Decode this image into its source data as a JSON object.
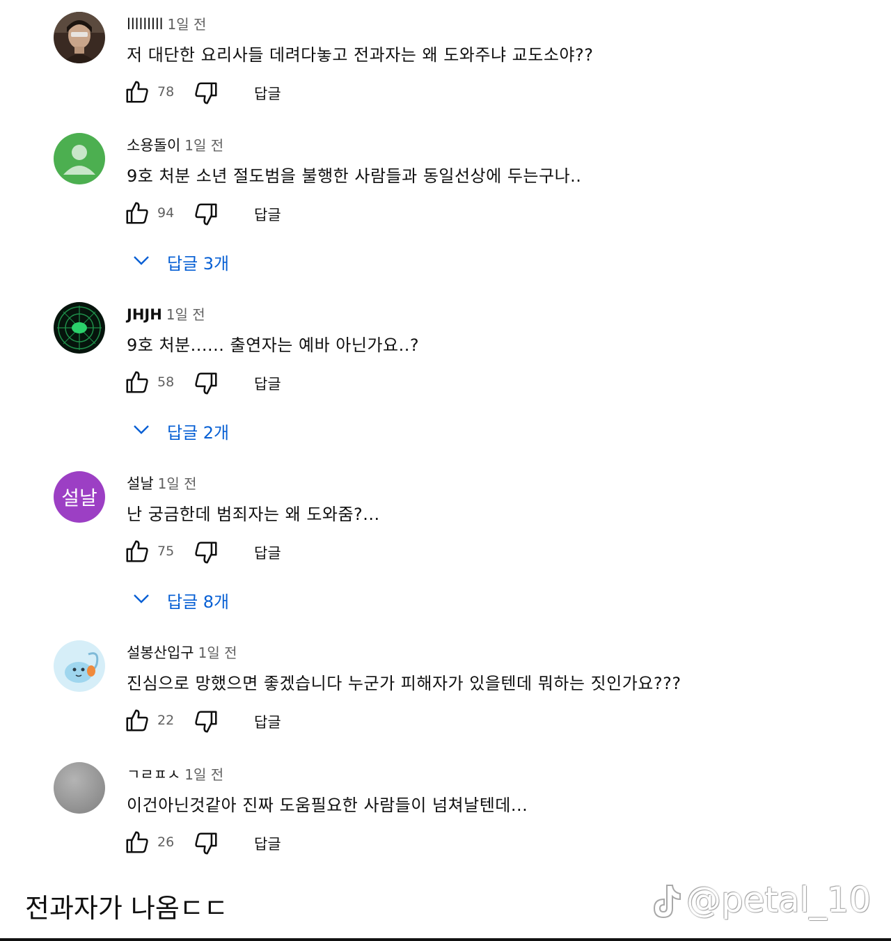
{
  "colors": {
    "link_blue": "#065fd4",
    "secondary_text": "#606060",
    "avatar_green": "#4caf50",
    "avatar_purple": "#9c3fc4",
    "avatar_gray": "#9e9e9e"
  },
  "ui": {
    "reply_label": "답글"
  },
  "comments": [
    {
      "author": "lllllllll",
      "time": "1일 전",
      "text": "저 대단한 요리사들 데려다놓고 전과자는 왜 도와주냐 교도소야??",
      "likes": "78",
      "avatar": "photo-avatar"
    },
    {
      "author": "소용돌이",
      "time": "1일 전",
      "text": "9호 처분 소년 절도범을 불행한 사람들과 동일선상에 두는구나..",
      "likes": "94",
      "avatar": "default-person-icon",
      "replies_label": "답글 3개"
    },
    {
      "author": "JHJH",
      "time": "1일 전",
      "text": "9호 처분...... 출연자는 예바 아닌가요..?",
      "likes": "58",
      "avatar": "radar-avatar",
      "replies_label": "답글 2개"
    },
    {
      "author": "설날",
      "time": "1일 전",
      "text": "난 궁금한데 범죄자는 왜 도와줌?...",
      "likes": "75",
      "avatar": "letter-avatar",
      "avatar_letters": "설날",
      "replies_label": "답글 8개"
    },
    {
      "author": "설봉산입구",
      "time": "1일 전",
      "text": "진심으로 망했으면 좋겠습니다 누군가 피해자가 있을텐데 뭐하는 짓인가요???",
      "likes": "22",
      "avatar": "cartoon-avatar"
    },
    {
      "author": "ㄱㄹㅍㅅ",
      "time": "1일 전",
      "text": "이건아닌것같아 진짜 도움필요한 사람들이 넘쳐날텐데...",
      "likes": "26",
      "avatar": "gray-avatar"
    }
  ],
  "caption": "전과자가 나옴ㄷㄷ",
  "watermark": {
    "text": "@petal_10",
    "icon": "tiktok-logo-icon"
  }
}
